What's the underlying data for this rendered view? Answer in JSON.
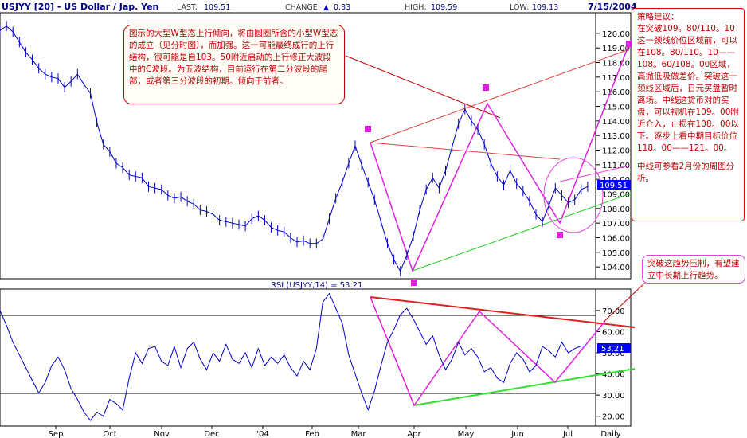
{
  "header": {
    "symbol": "USJYY [20] - US Dollar / Jap. Yen",
    "last_label": "LAST:",
    "last": "109.51",
    "change_label": "CHANGE:",
    "change_arrow": "▲",
    "change": "0.33",
    "high_label": "HIGH:",
    "high": "109.59",
    "low_label": "LOW:",
    "low": "109.13",
    "date": "7/15/2004"
  },
  "rsi_title": "RSI (USJYY,14) = 53.21",
  "notes": {
    "main": "图示的大型W型态上行倾向，将由圆圈所含的小型W型态的成立（见分时图），而加强。这一可能最终成行的上行结构，很可能是自103。50附近启动的上行修正大波段中的C波段。为五波结构，目前运行在第二分波段的尾部，或者第三分波段的初期。倾向于前者。",
    "strategy_title": "策略建议：",
    "strategy_body": "在突破109。80/110。10这一颈线价位区域前，可以在108。80/110。10——108。60/108。00区域，高抛低吸做差价。突破这一颈线区域后，日元买盘暂时离场。中线这货币对的买盘，可以视机在109。00附近介入，止损在108。00以下。逐步上看中期目标价位118。00——121。00。",
    "strategy_footer": "中线可参看2月份的周图分析。",
    "rsi": "突破这趋势压制，有望建立中长期上行趋势。"
  },
  "colors": {
    "price": "#0000c0",
    "neckline_upper": "#e04040",
    "support": "#20d020",
    "w_pattern": "#e020e0",
    "annotation": "#c00000",
    "highlight_box": "#0000ff"
  },
  "chart_data": [
    {
      "type": "line",
      "title": "USJYY [20] - US Dollar / Jap. Yen",
      "y_ticks": [
        "104.00",
        "105.00",
        "106.00",
        "107.00",
        "108.00",
        "109.00",
        "110.00",
        "111.00",
        "112.00",
        "113.00",
        "114.00",
        "115.00",
        "116.00",
        "117.00",
        "118.00",
        "119.00",
        "120.00"
      ],
      "ylim": [
        103.3,
        121.3
      ],
      "x_ticks": [
        "Sep",
        "Oct",
        "Nov",
        "Dec",
        "'04",
        "Feb",
        "Mar",
        "Apr",
        "May",
        "Jun",
        "Jul",
        "Daily"
      ],
      "last_value_label": "109.51",
      "series": [
        {
          "x": [
            0,
            3,
            6,
            9,
            12,
            15,
            18,
            21,
            24,
            27,
            30,
            33,
            36,
            39,
            42,
            45,
            48,
            51,
            54,
            57,
            60,
            63,
            66,
            69,
            72,
            75,
            78,
            81,
            84,
            87,
            90,
            93,
            96,
            99,
            102,
            105,
            108,
            111,
            114,
            117,
            120,
            123,
            126,
            129,
            132,
            135,
            138,
            141,
            144,
            147,
            150,
            153,
            156,
            159,
            162,
            165,
            168,
            171,
            174,
            177,
            180,
            183,
            186,
            189,
            192,
            195,
            198,
            201,
            204,
            207,
            210,
            213,
            216,
            219,
            222,
            225,
            228,
            231,
            234,
            237,
            240,
            243,
            246,
            249,
            252,
            255,
            258,
            261,
            264,
            267,
            270,
            273
          ],
          "values": [
            120.2,
            120.5,
            120.1,
            119.4,
            118.7,
            118.2,
            117.6,
            117.2,
            117.0,
            116.9,
            116.3,
            116.7,
            117.2,
            116.5,
            115.9,
            113.9,
            112.4,
            111.9,
            111.1,
            110.8,
            110.3,
            110.2,
            110.1,
            109.5,
            109.4,
            109.3,
            108.9,
            108.7,
            108.8,
            108.5,
            108.3,
            107.9,
            107.8,
            107.6,
            107.2,
            107.1,
            107.0,
            106.9,
            106.8,
            107.3,
            107.5,
            107.2,
            106.7,
            106.5,
            106.4,
            106.0,
            105.7,
            105.8,
            105.6,
            105.6,
            105.9,
            107.3,
            108.7,
            109.8,
            111.1,
            112.3,
            111.0,
            109.8,
            108.6,
            107.1,
            105.6,
            104.5,
            103.7,
            104.8,
            106.1,
            107.9,
            109.3,
            110.1,
            109.4,
            110.6,
            112.2,
            113.8,
            114.8,
            114.0,
            113.4,
            112.4,
            111.1,
            110.2,
            109.6,
            110.6,
            109.7,
            109.2,
            108.5,
            107.6,
            107.1,
            108.2,
            109.4,
            108.9,
            108.4,
            108.6,
            109.3,
            109.5
          ]
        }
      ]
    },
    {
      "type": "line",
      "title": "RSI (USJYY,14) = 53.21",
      "y_ticks": [
        "20.00",
        "30.00",
        "40.00",
        "50.00",
        "60.00",
        "70.00"
      ],
      "ylim": [
        16.5,
        79
      ],
      "last_value_label": "53.21",
      "series": [
        {
          "x": [
            0,
            3,
            6,
            9,
            12,
            15,
            18,
            21,
            24,
            27,
            30,
            33,
            36,
            39,
            42,
            45,
            48,
            51,
            54,
            57,
            60,
            63,
            66,
            69,
            72,
            75,
            78,
            81,
            84,
            87,
            90,
            93,
            96,
            99,
            102,
            105,
            108,
            111,
            114,
            117,
            120,
            123,
            126,
            129,
            132,
            135,
            138,
            141,
            144,
            147,
            150,
            153,
            156,
            159,
            162,
            165,
            168,
            171,
            174,
            177,
            180,
            183,
            186,
            189,
            192,
            195,
            198,
            201,
            204,
            207,
            210,
            213,
            216,
            219,
            222,
            225,
            228,
            231,
            234,
            237,
            240,
            243,
            246,
            249,
            252,
            255,
            258,
            261,
            264,
            267,
            270,
            273
          ],
          "values": [
            70,
            63,
            55,
            49,
            43,
            37,
            31,
            36,
            44,
            48,
            42,
            33,
            28,
            22,
            18,
            22,
            20,
            28,
            26,
            23,
            38,
            50,
            45,
            52,
            53,
            46,
            44,
            53,
            43,
            52,
            55,
            47,
            42,
            50,
            46,
            54,
            47,
            45,
            50,
            43,
            52,
            44,
            48,
            45,
            49,
            43,
            39,
            46,
            42,
            52,
            74,
            78,
            71,
            64,
            49,
            40,
            31,
            23,
            32,
            44,
            55,
            61,
            68,
            71,
            66,
            60,
            54,
            58,
            49,
            42,
            47,
            55,
            49,
            52,
            48,
            41,
            43,
            38,
            36,
            45,
            50,
            47,
            41,
            44,
            53,
            51,
            48,
            55,
            50,
            52,
            53.2,
            53.21
          ]
        }
      ]
    }
  ]
}
